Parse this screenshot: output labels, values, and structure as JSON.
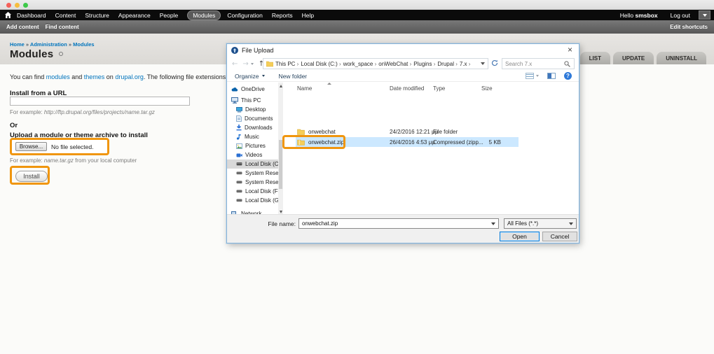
{
  "colors": {
    "accent_orange": "#f0960f",
    "link_blue": "#0074bd",
    "selection_blue": "#cce8ff",
    "open_button_border": "#0078d7",
    "toolbar_black": "#0b0b0b"
  },
  "admin_bar": {
    "items": [
      "Dashboard",
      "Content",
      "Structure",
      "Appearance",
      "People",
      "Modules",
      "Configuration",
      "Reports",
      "Help"
    ],
    "active_item": "Modules",
    "greeting": "Hello",
    "username": "smsbox",
    "logout": "Log out"
  },
  "shortcut_bar": {
    "items": [
      "Add content",
      "Find content"
    ],
    "edit": "Edit shortcuts"
  },
  "breadcrumb": [
    "Home",
    "Administration",
    "Modules"
  ],
  "page": {
    "title": "Modules",
    "tabs": [
      "LIST",
      "UPDATE",
      "UNINSTALL"
    ],
    "intro": {
      "pre": "You can find ",
      "link_modules": "modules",
      "and": " and ",
      "link_themes": "themes",
      "on": " on ",
      "link_drupal": "drupal.org",
      "post": ". The following file extensions are suppor"
    },
    "install_url": {
      "label": "Install from a URL",
      "value": "",
      "example_prefix": "For example: ",
      "example_url": "http://ftp.drupal.org/files/projects/name.tar.gz"
    },
    "or_label": "Or",
    "upload": {
      "label": "Upload a module or theme archive to install",
      "browse_label": "Browse...",
      "no_file": "No file selected.",
      "example_prefix": "For example: ",
      "example_file": "name.tar.gz",
      "example_suffix": " from your local computer"
    },
    "install_button": "Install"
  },
  "dialog": {
    "title": "File Upload",
    "path": [
      "This PC",
      "Local Disk (C:)",
      "work_space",
      "onWebChat",
      "Plugins",
      "Drupal",
      "7.x"
    ],
    "search_placeholder": "Search 7.x",
    "toolbar": {
      "organize": "Organize",
      "new_folder": "New folder"
    },
    "sidebar": [
      {
        "label": "OneDrive"
      },
      {
        "label": "This PC"
      },
      {
        "label": "Desktop"
      },
      {
        "label": "Documents"
      },
      {
        "label": "Downloads"
      },
      {
        "label": "Music"
      },
      {
        "label": "Pictures"
      },
      {
        "label": "Videos"
      },
      {
        "label": "Local Disk (C:)"
      },
      {
        "label": "System Reserved"
      },
      {
        "label": "System Reserved"
      },
      {
        "label": "Local Disk (F:)"
      },
      {
        "label": "Local Disk (G:)"
      },
      {
        "label": "Network"
      }
    ],
    "columns": [
      "Name",
      "Date modified",
      "Type",
      "Size"
    ],
    "files": [
      {
        "name": "onwebchat",
        "date": "24/2/2016 12:21 μμ",
        "type": "File folder",
        "size": ""
      },
      {
        "name": "onwebchat.zip",
        "date": "26/4/2016 4:53 μμ",
        "type": "Compressed (zipp...",
        "size": "5 KB"
      }
    ],
    "file_name_label": "File name:",
    "file_name_value": "onwebchat.zip",
    "file_type_value": "All Files (*.*)",
    "open_label": "Open",
    "cancel_label": "Cancel"
  }
}
